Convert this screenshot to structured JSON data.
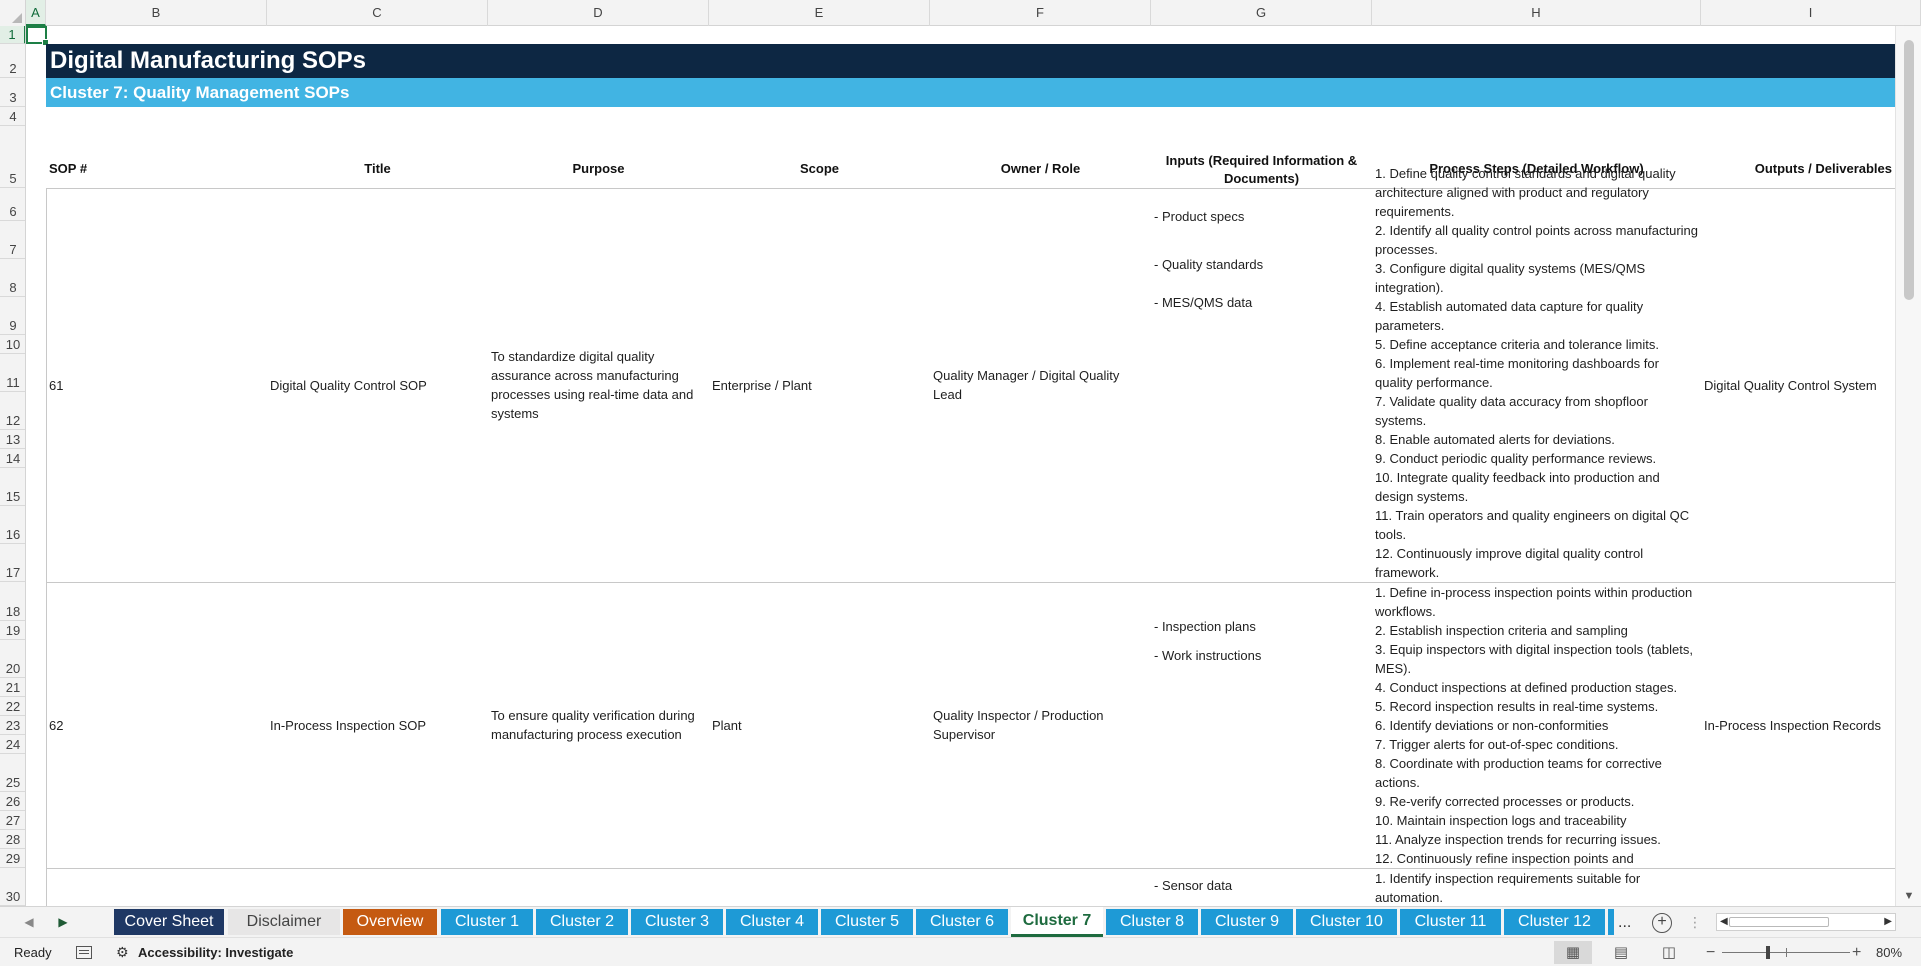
{
  "app": {
    "name": "Excel",
    "active_cell": "A1"
  },
  "columns": [
    "A",
    "B",
    "C",
    "D",
    "E",
    "F",
    "G",
    "H",
    "I"
  ],
  "active_column": "A",
  "rows": [
    "1",
    "2",
    "3",
    "4",
    "5",
    "6",
    "7",
    "8",
    "9",
    "10",
    "11",
    "12",
    "13",
    "14",
    "15",
    "16",
    "17",
    "18",
    "19",
    "20",
    "21",
    "22",
    "23",
    "24",
    "25",
    "26",
    "27",
    "28",
    "29",
    "30"
  ],
  "active_row": "1",
  "sheet": {
    "title": "Digital Manufacturing SOPs",
    "subtitle": "Cluster 7: Quality Management SOPs",
    "headers": [
      "SOP #",
      "Title",
      "Purpose",
      "Scope",
      "Owner / Role",
      "Inputs (Required Information & Documents)",
      "Process Steps (Detailed Workflow)",
      "Outputs / Deliverables"
    ],
    "records": [
      {
        "sop": "61",
        "title": "Digital Quality Control SOP",
        "purpose": "To standardize digital quality assurance across manufacturing processes using real-time data and systems",
        "scope": "Enterprise / Plant",
        "owner": "Quality Manager / Digital Quality Lead",
        "inputs": [
          "- Product specs",
          "- Quality standards",
          "- MES/QMS data"
        ],
        "steps": [
          "1. Define quality control standards and digital quality architecture aligned with product and regulatory requirements.",
          "2. Identify all quality control points across manufacturing processes.",
          "3. Configure digital quality systems (MES/QMS integration).",
          "4. Establish automated data capture for quality parameters.",
          "5. Define acceptance criteria and tolerance limits.",
          "6. Implement real-time monitoring dashboards for quality performance.",
          "7. Validate quality data accuracy from shopfloor systems.",
          "8. Enable automated alerts for deviations.",
          "9. Conduct periodic quality performance reviews.",
          "10. Integrate quality feedback into production and design systems.",
          "11. Train operators and quality engineers on digital QC tools.",
          "12. Continuously improve digital quality control framework."
        ],
        "output": "Digital Quality Control System"
      },
      {
        "sop": "62",
        "title": "In-Process Inspection SOP",
        "purpose": "To ensure quality verification during manufacturing process execution",
        "scope": "Plant",
        "owner": "Quality Inspector / Production Supervisor",
        "inputs": [
          "- Inspection plans",
          "- Work instructions"
        ],
        "steps": [
          "1. Define in-process inspection points within production workflows.",
          "2. Establish inspection criteria and sampling",
          "3. Equip inspectors with digital inspection tools (tablets, MES).",
          "4. Conduct inspections at defined production stages.",
          "5. Record inspection results in real-time systems.",
          "6. Identify deviations or non-conformities",
          "7. Trigger alerts for out-of-spec conditions.",
          "8. Coordinate with production teams for corrective actions.",
          "9. Re-verify corrected processes or products.",
          "10. Maintain inspection logs and traceability",
          "11. Analyze inspection trends for recurring issues.",
          "12. Continuously refine inspection points and"
        ],
        "output": "In-Process Inspection Records"
      },
      {
        "inputs": [
          "- Sensor data"
        ],
        "steps": [
          "1. Identify inspection requirements suitable for automation."
        ]
      }
    ]
  },
  "tabs": [
    {
      "label": "Cover Sheet",
      "color": "#1f3864"
    },
    {
      "label": "Disclaimer",
      "color": "#e7e6e6"
    },
    {
      "label": "Overview",
      "color": "#c55a11"
    },
    {
      "label": "Cluster 1",
      "color": "#1e9ad6"
    },
    {
      "label": "Cluster 2",
      "color": "#1e9ad6"
    },
    {
      "label": "Cluster 3",
      "color": "#1e9ad6"
    },
    {
      "label": "Cluster 4",
      "color": "#1e9ad6"
    },
    {
      "label": "Cluster 5",
      "color": "#1e9ad6"
    },
    {
      "label": "Cluster 6",
      "color": "#1e9ad6"
    },
    {
      "label": "Cluster 7",
      "color": "#1e9ad6"
    },
    {
      "label": "Cluster 8",
      "color": "#1e9ad6"
    },
    {
      "label": "Cluster 9",
      "color": "#1e9ad6"
    },
    {
      "label": "Cluster 10",
      "color": "#1e9ad6"
    },
    {
      "label": "Cluster 11",
      "color": "#1e9ad6"
    },
    {
      "label": "Cluster 12",
      "color": "#1e9ad6"
    }
  ],
  "active_tab": "Cluster 7",
  "tab_overflow": "...",
  "status": {
    "ready": "Ready",
    "accessibility": "Accessibility: Investigate",
    "zoom": "80%"
  },
  "colors": {
    "title_band": "#0d2743",
    "subtitle_band": "#41b4e3",
    "accent": "#1d7f46"
  }
}
